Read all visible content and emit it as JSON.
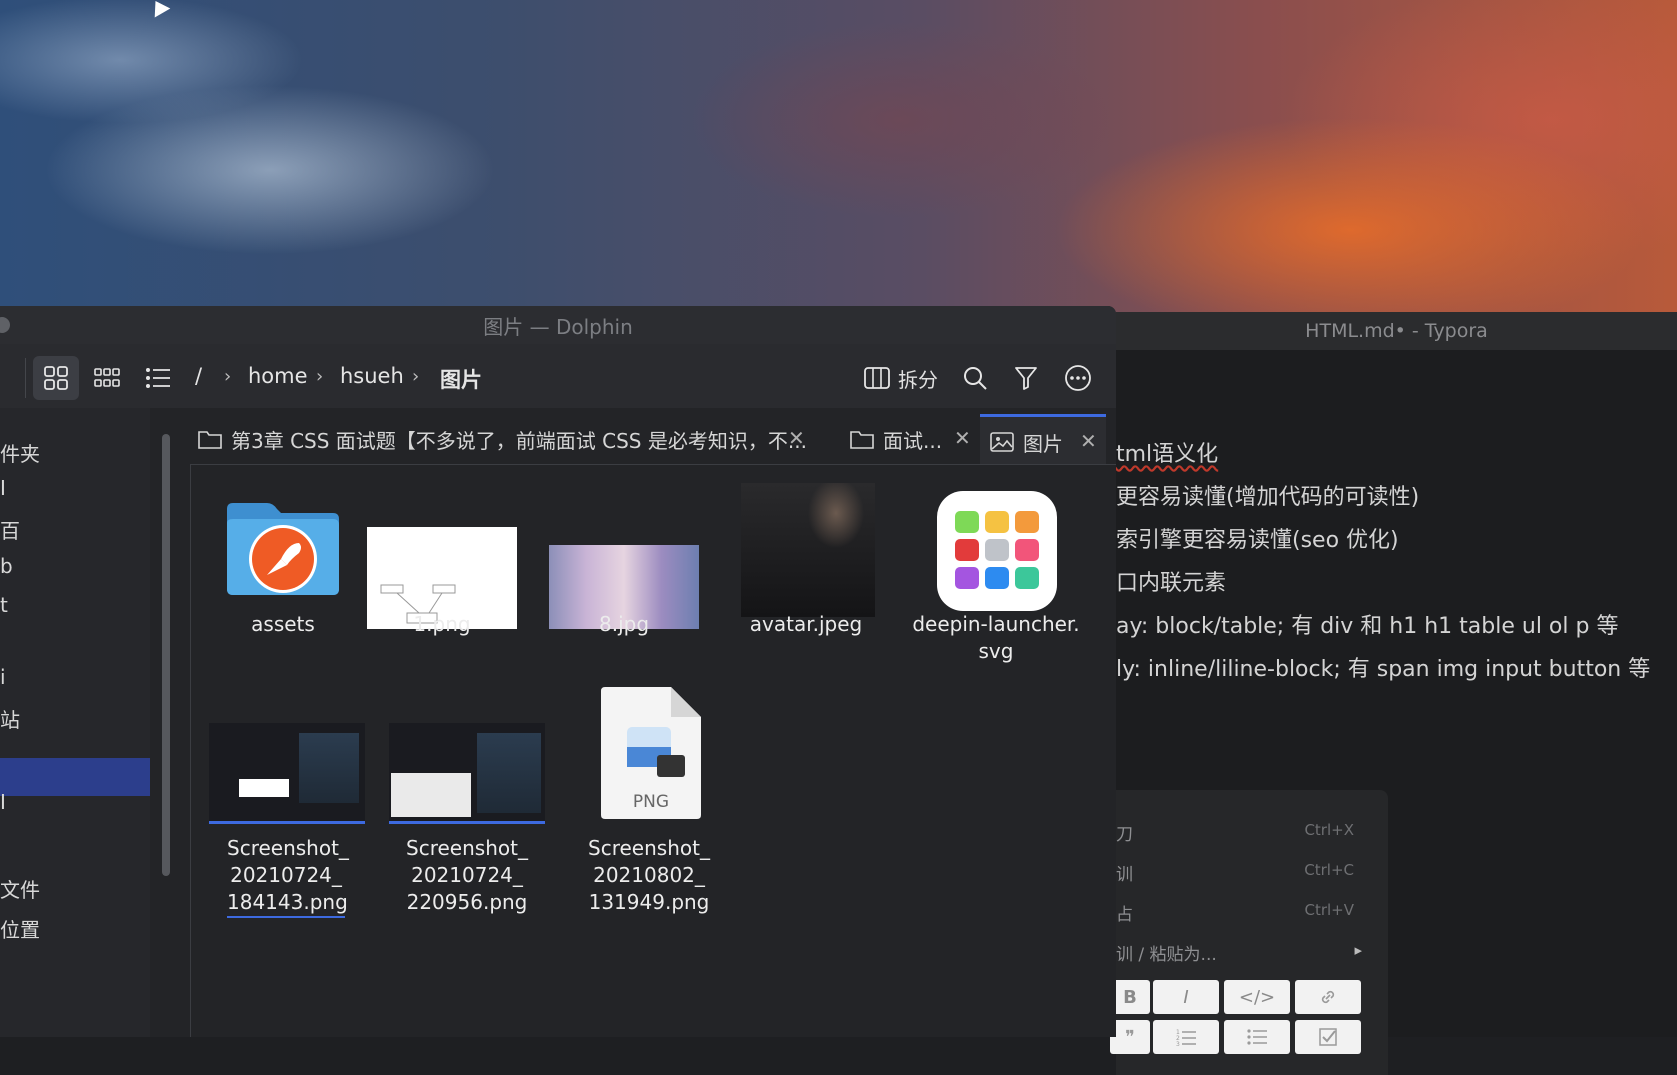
{
  "typora": {
    "title": "HTML.md• - Typora",
    "lines": [
      "tml语义化",
      "更容易读懂(增加代码的可读性)",
      "索引擎更容易读懂(seo 优化)",
      "口内联元素",
      "ay: block/table; 有 div 和 h1 h1 table ul ol p 等",
      "ly: inline/liline-block; 有 span img input button 等"
    ],
    "context_menu": {
      "items": [
        {
          "label": "刀",
          "shortcut": "Ctrl+X"
        },
        {
          "label": "训",
          "shortcut": "Ctrl+C"
        },
        {
          "label": "占",
          "shortcut": "Ctrl+V"
        },
        {
          "label": "训 / 粘贴为...",
          "shortcut": ""
        }
      ],
      "format_buttons_row1": [
        "B",
        "I",
        "</>",
        "link"
      ],
      "format_buttons_row2": [
        "quote",
        "ordered-list",
        "bullet-list",
        "task-list"
      ]
    }
  },
  "dolphin": {
    "title": "图片 — Dolphin",
    "breadcrumb": [
      "/",
      "home",
      "hsueh",
      "图片"
    ],
    "split_label": "拆分",
    "sidebar_items": [
      "件夹",
      "I",
      "百",
      "b",
      "t",
      "",
      "i",
      "站",
      "",
      "I",
      "文件",
      "位置"
    ],
    "tabs": [
      {
        "label": "第3章 CSS 面试题【不多说了，前端面试 CSS 是必考知识，不...",
        "icon": "folder-icon"
      },
      {
        "label": "面试...",
        "icon": "folder-icon"
      },
      {
        "label": "图片",
        "icon": "image-icon"
      }
    ],
    "files": [
      {
        "name": "assets",
        "type": "folder"
      },
      {
        "name": "1.png",
        "type": "image"
      },
      {
        "name": "8.jpg",
        "type": "image"
      },
      {
        "name": "avatar.jpeg",
        "type": "image"
      },
      {
        "name": "deepin-launcher.\nsvg",
        "type": "svg"
      },
      {
        "name": "Screenshot_\n20210724_\n184143.png",
        "type": "image"
      },
      {
        "name": "Screenshot_\n20210724_\n220956.png",
        "type": "image"
      },
      {
        "name": "Screenshot_\n20210802_\n131949.png",
        "type": "png-file",
        "badge": "PNG"
      }
    ]
  },
  "colors": {
    "accent": "#3d6ae0",
    "sidebar_selected": "#2c3e8c",
    "folder_blue": "#4fa6e0",
    "postman_orange": "#ef5b25"
  }
}
